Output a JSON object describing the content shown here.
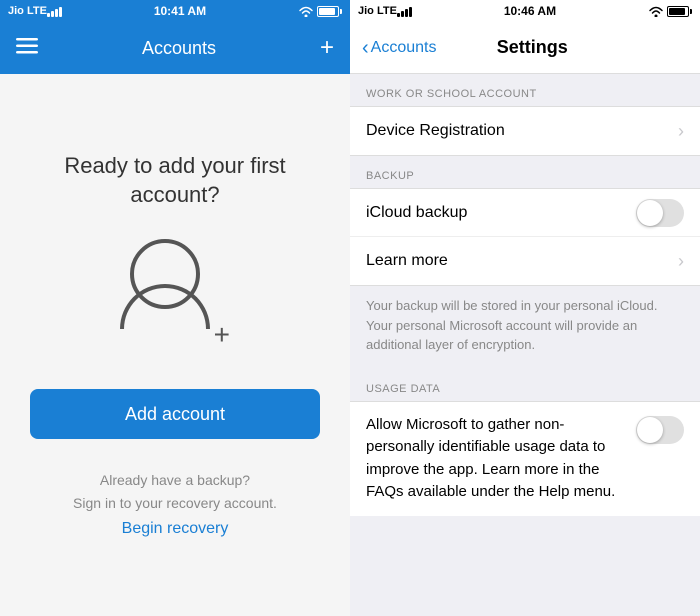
{
  "left": {
    "statusBar": {
      "carrier": "Jio  LTE",
      "time": "10:41 AM"
    },
    "navBar": {
      "title": "Accounts",
      "addLabel": "+"
    },
    "promptText": "Ready to add your first account?",
    "addAccountLabel": "Add account",
    "recoveryLine1": "Already have a backup?",
    "recoveryLine2": "Sign in to your recovery account.",
    "beginRecoveryLabel": "Begin recovery"
  },
  "right": {
    "statusBar": {
      "carrier": "Jio  LTE",
      "time": "10:46 AM"
    },
    "navBar": {
      "backLabel": "Accounts",
      "title": "Settings"
    },
    "sections": [
      {
        "label": "WORK OR SCHOOL ACCOUNT",
        "rows": [
          {
            "label": "Device Registration",
            "type": "chevron"
          }
        ]
      },
      {
        "label": "BACKUP",
        "rows": [
          {
            "label": "iCloud backup",
            "type": "toggle"
          },
          {
            "label": "Learn more",
            "type": "chevron"
          }
        ],
        "infoText": "Your backup will be stored in your personal iCloud. Your personal Microsoft account will provide an additional layer of encryption."
      },
      {
        "label": "USAGE DATA",
        "usageText": "Allow Microsoft to gather non-personally identifiable usage data to improve the app. Learn more in the FAQs available under the Help menu.",
        "usageType": "toggle"
      }
    ]
  }
}
